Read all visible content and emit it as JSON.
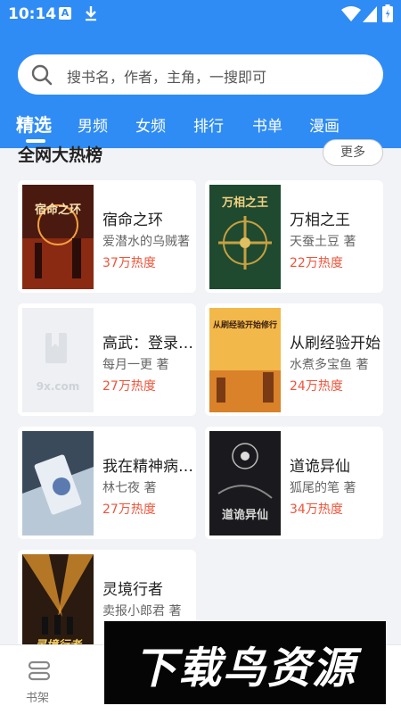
{
  "status_bar": {
    "time": "10:14",
    "app_badge": "A"
  },
  "search": {
    "placeholder": "搜书名，作者，主角，一搜即可"
  },
  "tabs": [
    {
      "label": "精选",
      "active": true
    },
    {
      "label": "男频"
    },
    {
      "label": "女频"
    },
    {
      "label": "排行"
    },
    {
      "label": "书单"
    },
    {
      "label": "漫画"
    }
  ],
  "section": {
    "title": "全网大热榜",
    "more_label": "更多"
  },
  "books": [
    {
      "title": "宿命之环",
      "author": "爱潜水的乌贼著",
      "heat": "37万热度",
      "cover_text": "宿命之环"
    },
    {
      "title": "万相之王",
      "author": "天蚕土豆 著",
      "heat": "22万热度",
      "cover_text": "万相之王"
    },
    {
      "title": "高武：登录未来一万年",
      "author": "每月一更 著",
      "heat": "27万热度",
      "cover_text": "9x.com"
    },
    {
      "title": "从刷经验开始",
      "author": "水煮多宝鱼 著",
      "heat": "24万热度",
      "cover_text": "从刷经验开始修行"
    },
    {
      "title": "我在精神病院学斩神",
      "author": "林七夜 著",
      "heat": "27万热度",
      "cover_text": ""
    },
    {
      "title": "道诡异仙",
      "author": "狐尾的笔 著",
      "heat": "34万热度",
      "cover_text": "道诡异仙"
    },
    {
      "title": "灵境行者",
      "author": "卖报小郎君 著",
      "heat": "",
      "cover_text": "灵境行者"
    }
  ],
  "bottom_nav": {
    "shelf_label": "书架"
  },
  "watermark": {
    "text": "下载鸟资源"
  },
  "colors": {
    "primary": "#2f8cf5",
    "heat": "#f0543a",
    "background": "#f2f3f7"
  }
}
